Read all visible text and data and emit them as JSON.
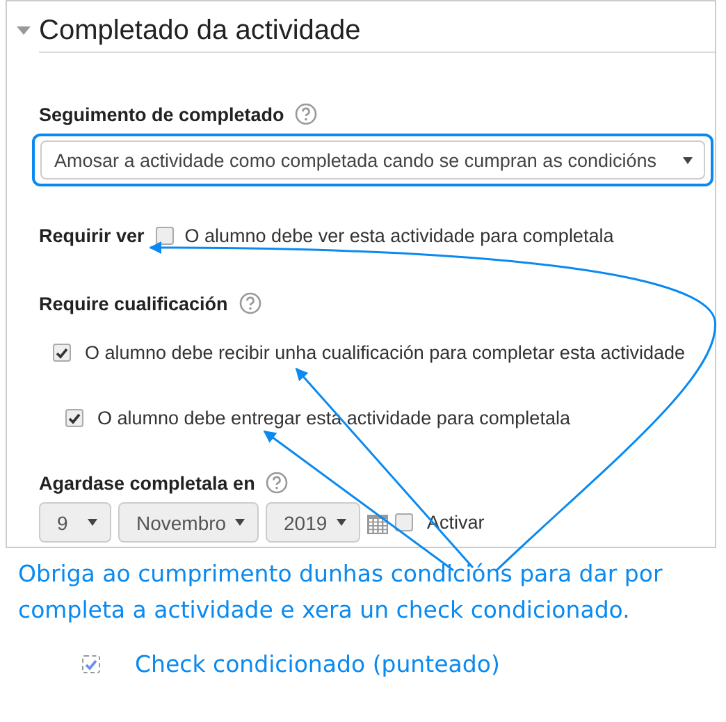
{
  "section": {
    "title": "Completado da actividade",
    "expanded": true
  },
  "completion_tracking": {
    "label": "Seguimento de completado",
    "value": "Amosar a actividade como completada cando se cumpran as condicións"
  },
  "require_view": {
    "label": "Requirir ver",
    "checked": false,
    "text": "O alumno debe ver esta actividade para completala"
  },
  "require_grade": {
    "label": "Require cualificación",
    "options": [
      {
        "label": "O alumno debe recibir unha cualificación para completar esta actividade",
        "checked": true
      },
      {
        "label": "O alumno debe entregar esta actividade para completala",
        "checked": true
      }
    ]
  },
  "expected_by": {
    "label": "Agardase completala en",
    "day": "9",
    "month": "Novembro",
    "year": "2019",
    "enable": {
      "label": "Activar",
      "checked": false
    }
  },
  "annotation": "Obriga ao cumprimento dunhas condicións para dar por completa a actividade e xera un check condicionado.",
  "legend": {
    "text": "Check condicionado (punteado)",
    "checked": true
  }
}
